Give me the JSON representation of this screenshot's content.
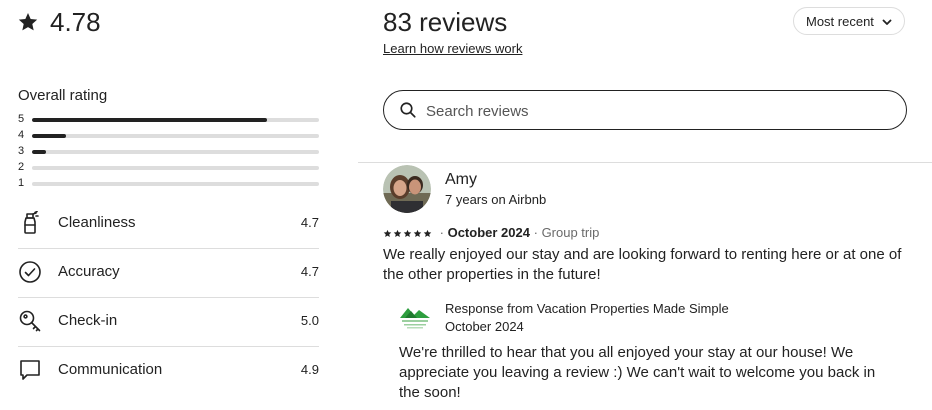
{
  "summary": {
    "overall_rating": "4.78",
    "overall_label": "Overall rating",
    "histogram": [
      {
        "stars": "5",
        "fraction": 0.82
      },
      {
        "stars": "4",
        "fraction": 0.12
      },
      {
        "stars": "3",
        "fraction": 0.05
      },
      {
        "stars": "2",
        "fraction": 0
      },
      {
        "stars": "1",
        "fraction": 0
      }
    ],
    "categories": [
      {
        "label": "Cleanliness",
        "value": "4.7",
        "icon": "spray-bottle-icon"
      },
      {
        "label": "Accuracy",
        "value": "4.7",
        "icon": "check-circle-icon"
      },
      {
        "label": "Check-in",
        "value": "5.0",
        "icon": "key-icon"
      },
      {
        "label": "Communication",
        "value": "4.9",
        "icon": "chat-bubble-icon"
      }
    ]
  },
  "reviews_header": {
    "title": "83 reviews",
    "learn_link": "Learn how reviews work",
    "sort_label": "Most recent"
  },
  "search": {
    "placeholder": "Search reviews"
  },
  "review": {
    "name": "Amy",
    "tenure": "7 years on Airbnb",
    "stars": 5,
    "date": "October 2024",
    "separator": "·",
    "trip_type": "Group trip",
    "body": "We really enjoyed our stay and are looking forward to renting here or at one of the other properties in the future!",
    "response": {
      "title": "Response from Vacation Properties Made Simple",
      "date": "October 2024",
      "body": "We're thrilled to hear that you all enjoyed your stay at our house! We appreciate you leaving a review :) We can't wait to welcome you back in the soon!"
    }
  },
  "colors": {
    "text": "#222222",
    "muted": "#6a6a6a",
    "divider": "#dddddd",
    "brand_green": "#2e9e3f"
  }
}
